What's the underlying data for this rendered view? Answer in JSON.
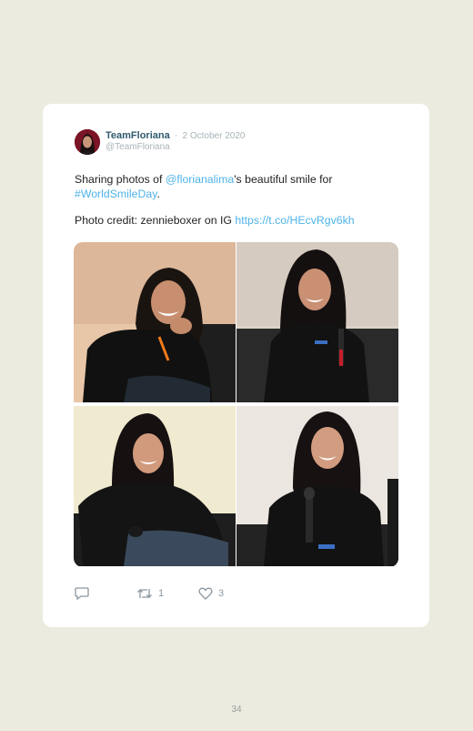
{
  "tweet": {
    "author_name": "TeamFloriana",
    "separator": "·",
    "date": "2 October 2020",
    "handle": "@TeamFloriana",
    "line1_pre": "Sharing photos of ",
    "mention": "@florianalima",
    "line1_post": "'s beautiful smile for",
    "hashtag": "#WorldSmileDay",
    "hashtag_post": ".",
    "credit_text": "Photo credit: zennieboxer on IG ",
    "credit_link": "https://t.co/HEcvRgv6kh",
    "photos": [
      {
        "name": "photo-1"
      },
      {
        "name": "photo-2"
      },
      {
        "name": "photo-3"
      },
      {
        "name": "photo-4"
      }
    ],
    "actions": {
      "reply_count": "",
      "retweet_count": "1",
      "like_count": "3"
    }
  },
  "page": {
    "number": "34"
  },
  "colors": {
    "background": "#ebebdf",
    "card": "#ffffff",
    "author": "#2f5a6e",
    "link": "#4fb3e8",
    "muted": "#a9b3b8"
  },
  "icons": [
    "reply-icon",
    "retweet-icon",
    "like-icon"
  ]
}
